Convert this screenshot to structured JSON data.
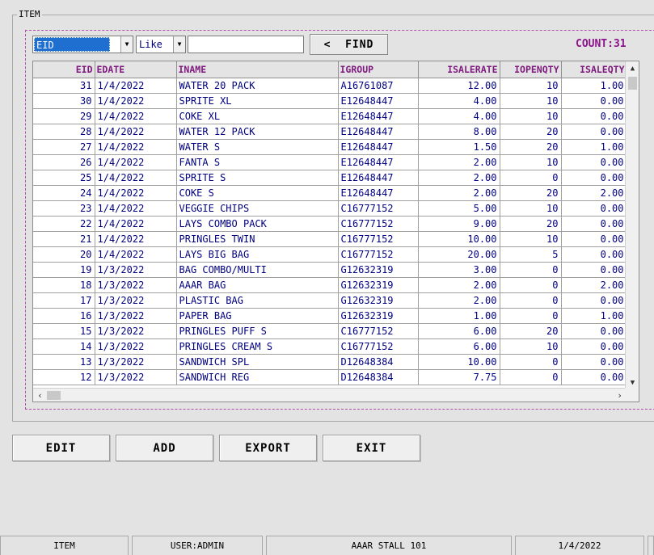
{
  "group_title": "ITEM",
  "filter": {
    "field_value": "EID",
    "operator_value": "Like",
    "search_value": "",
    "find_label": "<  FIND"
  },
  "count_label": "COUNT:31",
  "grid": {
    "columns": [
      "EID",
      "EDATE",
      "INAME",
      "IGROUP",
      "ISALERATE",
      "IOPENQTY",
      "ISALEQTY"
    ],
    "rows": [
      [
        "31",
        "1/4/2022",
        "WATER 20 PACK",
        "A16761087",
        "12.00",
        "10",
        "1.00"
      ],
      [
        "30",
        "1/4/2022",
        "SPRITE XL",
        "E12648447",
        "4.00",
        "10",
        "0.00"
      ],
      [
        "29",
        "1/4/2022",
        "COKE XL",
        "E12648447",
        "4.00",
        "10",
        "0.00"
      ],
      [
        "28",
        "1/4/2022",
        "WATER 12 PACK",
        "E12648447",
        "8.00",
        "20",
        "0.00"
      ],
      [
        "27",
        "1/4/2022",
        "WATER S",
        "E12648447",
        "1.50",
        "20",
        "1.00"
      ],
      [
        "26",
        "1/4/2022",
        "FANTA S",
        "E12648447",
        "2.00",
        "10",
        "0.00"
      ],
      [
        "25",
        "1/4/2022",
        "SPRITE S",
        "E12648447",
        "2.00",
        "0",
        "0.00"
      ],
      [
        "24",
        "1/4/2022",
        "COKE S",
        "E12648447",
        "2.00",
        "20",
        "2.00"
      ],
      [
        "23",
        "1/4/2022",
        "VEGGIE CHIPS",
        "C16777152",
        "5.00",
        "10",
        "0.00"
      ],
      [
        "22",
        "1/4/2022",
        "LAYS COMBO PACK",
        "C16777152",
        "9.00",
        "20",
        "0.00"
      ],
      [
        "21",
        "1/4/2022",
        "PRINGLES TWIN",
        "C16777152",
        "10.00",
        "10",
        "0.00"
      ],
      [
        "20",
        "1/4/2022",
        "LAYS BIG BAG",
        "C16777152",
        "20.00",
        "5",
        "0.00"
      ],
      [
        "19",
        "1/3/2022",
        "BAG COMBO/MULTI",
        "G12632319",
        "3.00",
        "0",
        "0.00"
      ],
      [
        "18",
        "1/3/2022",
        "AAAR BAG",
        "G12632319",
        "2.00",
        "0",
        "2.00"
      ],
      [
        "17",
        "1/3/2022",
        "PLASTIC BAG",
        "G12632319",
        "2.00",
        "0",
        "0.00"
      ],
      [
        "16",
        "1/3/2022",
        "PAPER BAG",
        "G12632319",
        "1.00",
        "0",
        "1.00"
      ],
      [
        "15",
        "1/3/2022",
        "PRINGLES PUFF S",
        "C16777152",
        "6.00",
        "20",
        "0.00"
      ],
      [
        "14",
        "1/3/2022",
        "PRINGLES CREAM S",
        "C16777152",
        "6.00",
        "10",
        "0.00"
      ],
      [
        "13",
        "1/3/2022",
        "SANDWICH SPL",
        "D12648384",
        "10.00",
        "0",
        "0.00"
      ],
      [
        "12",
        "1/3/2022",
        "SANDWICH REG",
        "D12648384",
        "7.75",
        "0",
        "0.00"
      ]
    ]
  },
  "buttons": {
    "edit": "EDIT",
    "add": "ADD",
    "export": "EXPORT",
    "exit": "EXIT"
  },
  "status": {
    "screen": "ITEM",
    "user": "USER:ADMIN",
    "stall": "AAAR STALL 101",
    "date": "1/4/2022"
  },
  "colors": {
    "header_text": "#7e1a7e",
    "cell_text": "#000080",
    "count_text": "#8b158b",
    "frame_dashes": "#b04fb0",
    "selected_field_bg": "#1f6fd1"
  },
  "icons": {
    "dropdown": "chevron-down-icon",
    "scroll_up": "arrow-up-icon",
    "scroll_down": "arrow-down-icon",
    "scroll_left": "arrow-left-icon",
    "scroll_right": "arrow-right-icon"
  }
}
